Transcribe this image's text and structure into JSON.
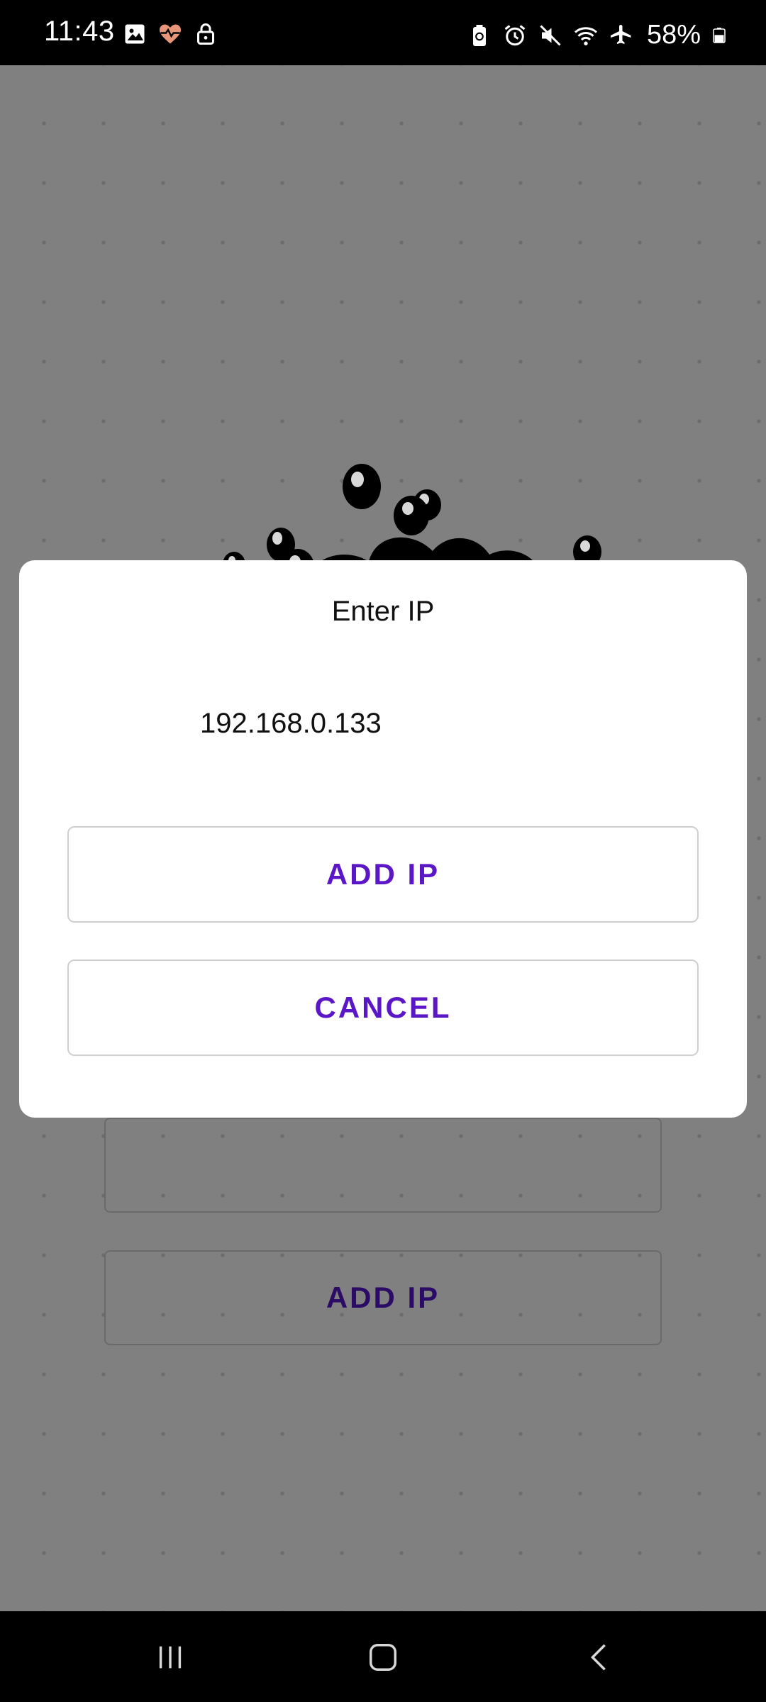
{
  "status_bar": {
    "time": "11:43",
    "left_icons": [
      "gallery-icon",
      "health-icon",
      "lock-icon"
    ],
    "right_icons": [
      "battery-saver-icon",
      "alarm-icon",
      "mute-icon",
      "wifi-icon",
      "airplane-icon"
    ],
    "battery_text": "58%",
    "battery_level": 0.58
  },
  "background": {
    "buttons": [
      {
        "label": ""
      },
      {
        "label": "ADD IP"
      }
    ]
  },
  "dialog": {
    "title": "Enter IP",
    "ip_value": "192.168.0.133",
    "add_button_label": "ADD IP",
    "cancel_button_label": "CANCEL"
  },
  "nav_bar": {
    "recents_icon": "recents-icon",
    "home_icon": "home-icon",
    "back_icon": "back-icon"
  },
  "colors": {
    "accent": "#5b16c7",
    "overlay": "#808080",
    "dialog_bg": "#ffffff"
  }
}
